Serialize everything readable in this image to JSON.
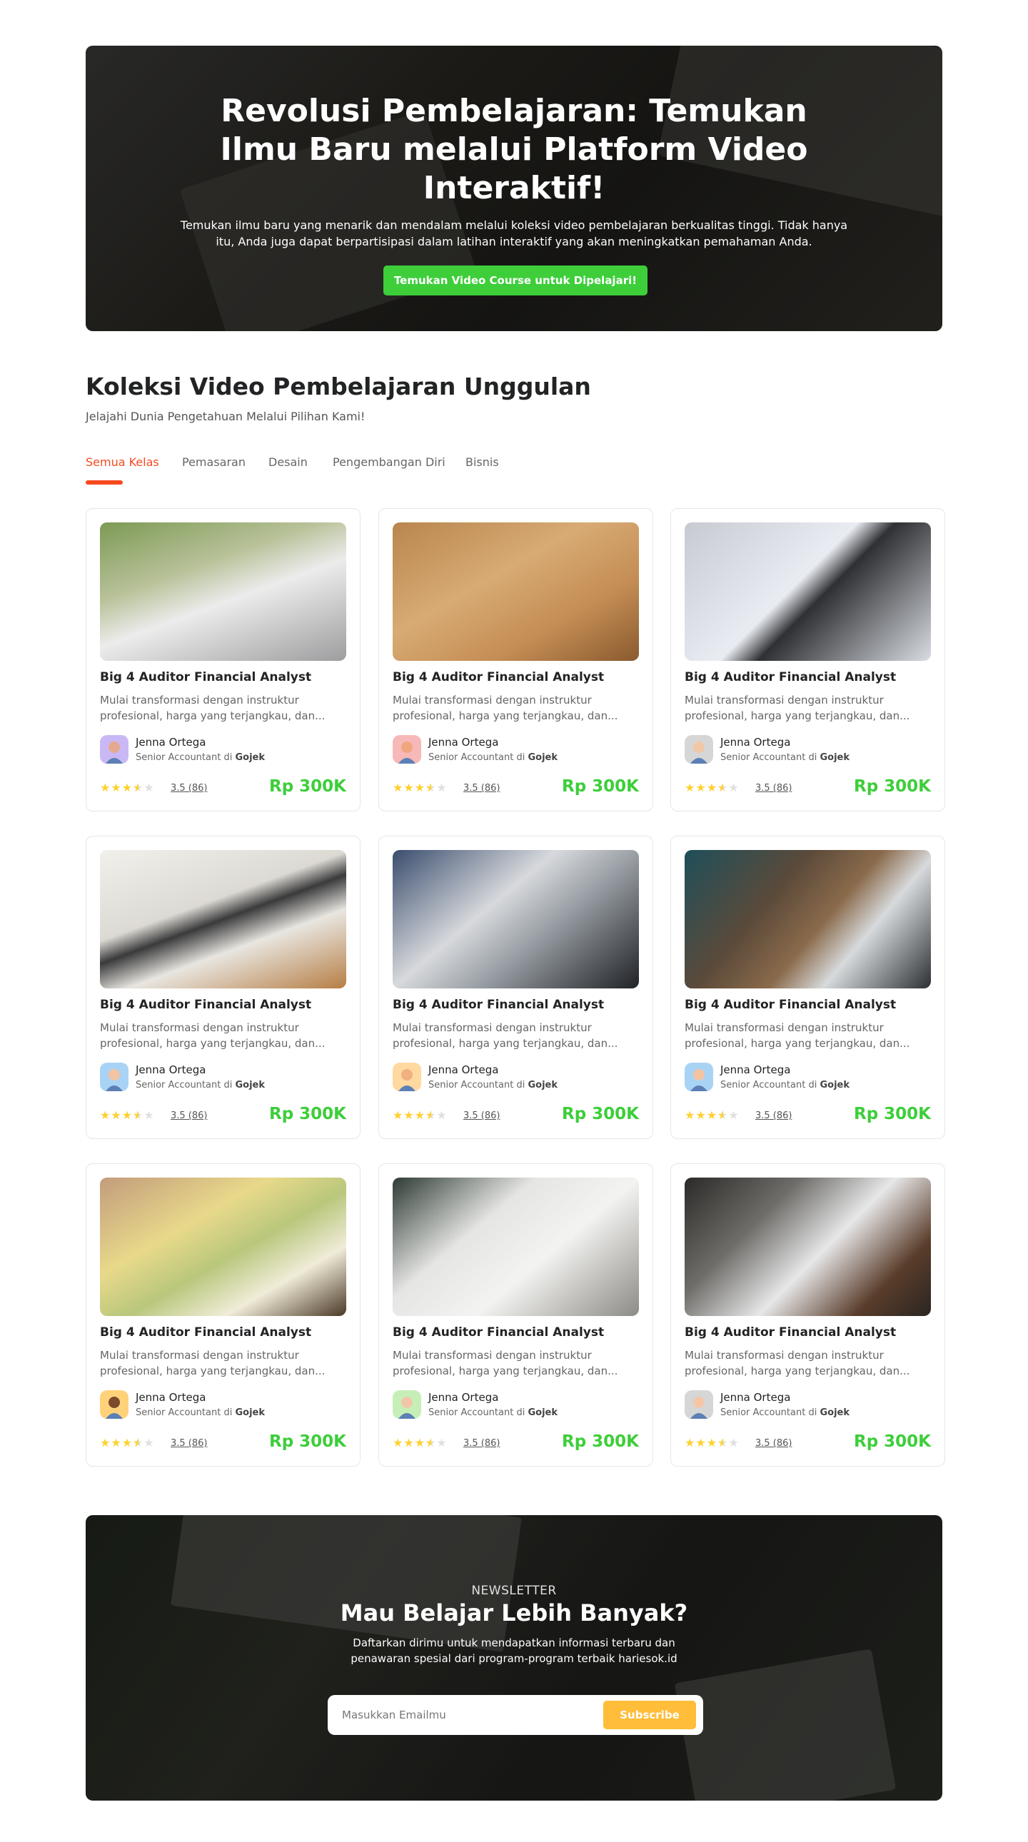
{
  "hero": {
    "title": "Revolusi Pembelajaran: Temukan Ilmu Baru melalui Platform Video Interaktif!",
    "description": "Temukan ilmu baru yang menarik dan mendalam melalui koleksi video pembelajaran berkualitas tinggi. Tidak hanya itu, Anda juga dapat berpartisipasi dalam latihan interaktif yang akan meningkatkan pemahaman Anda.",
    "cta_label": "Temukan Video Course untuk Dipelajari!"
  },
  "collection": {
    "title": "Koleksi Video Pembelajaran Unggulan",
    "subtitle": "Jelajahi Dunia Pengetahuan Melalui Pilihan Kami!",
    "tabs": [
      {
        "label": "Semua Kelas",
        "active": true
      },
      {
        "label": "Pemasaran",
        "active": false
      },
      {
        "label": "Desain",
        "active": false
      },
      {
        "label": "Pengembangan Diri",
        "active": false
      },
      {
        "label": "Bisnis",
        "active": false
      }
    ],
    "courses": [
      {
        "title": "Big 4 Auditor Financial Analyst",
        "description": "Mulai transformasi dengan instruktur profesional, harga yang terjangkau, dan...",
        "author": "Jenna Ortega",
        "role_prefix": "Senior Accountant di",
        "company": "Gojek",
        "rating": 3.5,
        "rating_label": "3.5 (86)",
        "price": "Rp 300K"
      },
      {
        "title": "Big 4 Auditor Financial Analyst",
        "description": "Mulai transformasi dengan instruktur profesional, harga yang terjangkau, dan...",
        "author": "Jenna Ortega",
        "role_prefix": "Senior Accountant di",
        "company": "Gojek",
        "rating": 3.5,
        "rating_label": "3.5 (86)",
        "price": "Rp 300K"
      },
      {
        "title": "Big 4 Auditor Financial Analyst",
        "description": "Mulai transformasi dengan instruktur profesional, harga yang terjangkau, dan...",
        "author": "Jenna Ortega",
        "role_prefix": "Senior Accountant di",
        "company": "Gojek",
        "rating": 3.5,
        "rating_label": "3.5 (86)",
        "price": "Rp 300K"
      },
      {
        "title": "Big 4 Auditor Financial Analyst",
        "description": "Mulai transformasi dengan instruktur profesional, harga yang terjangkau, dan...",
        "author": "Jenna Ortega",
        "role_prefix": "Senior Accountant di",
        "company": "Gojek",
        "rating": 3.5,
        "rating_label": "3.5 (86)",
        "price": "Rp 300K"
      },
      {
        "title": "Big 4 Auditor Financial Analyst",
        "description": "Mulai transformasi dengan instruktur profesional, harga yang terjangkau, dan...",
        "author": "Jenna Ortega",
        "role_prefix": "Senior Accountant di",
        "company": "Gojek",
        "rating": 3.5,
        "rating_label": "3.5 (86)",
        "price": "Rp 300K"
      },
      {
        "title": "Big 4 Auditor Financial Analyst",
        "description": "Mulai transformasi dengan instruktur profesional, harga yang terjangkau, dan...",
        "author": "Jenna Ortega",
        "role_prefix": "Senior Accountant di",
        "company": "Gojek",
        "rating": 3.5,
        "rating_label": "3.5 (86)",
        "price": "Rp 300K"
      },
      {
        "title": "Big 4 Auditor Financial Analyst",
        "description": "Mulai transformasi dengan instruktur profesional, harga yang terjangkau, dan...",
        "author": "Jenna Ortega",
        "role_prefix": "Senior Accountant di",
        "company": "Gojek",
        "rating": 3.5,
        "rating_label": "3.5 (86)",
        "price": "Rp 300K"
      },
      {
        "title": "Big 4 Auditor Financial Analyst",
        "description": "Mulai transformasi dengan instruktur profesional, harga yang terjangkau, dan...",
        "author": "Jenna Ortega",
        "role_prefix": "Senior Accountant di",
        "company": "Gojek",
        "rating": 3.5,
        "rating_label": "3.5 (86)",
        "price": "Rp 300K"
      },
      {
        "title": "Big 4 Auditor Financial Analyst",
        "description": "Mulai transformasi dengan instruktur profesional, harga yang terjangkau, dan...",
        "author": "Jenna Ortega",
        "role_prefix": "Senior Accountant di",
        "company": "Gojek",
        "rating": 3.5,
        "rating_label": "3.5 (86)",
        "price": "Rp 300K"
      }
    ]
  },
  "newsletter": {
    "label": "NEWSLETTER",
    "title": "Mau Belajar Lebih Banyak?",
    "description": "Daftarkan dirimu untuk mendapatkan informasi terbaru dan penawaran spesial dari program-program terbaik hariesok.id",
    "email_placeholder": "Masukkan Emailmu",
    "email_value": "",
    "subscribe_label": "Subscribe"
  },
  "colors": {
    "accent_orange": "#f64920",
    "price_green": "#3dce3a",
    "cta_green": "#3dce3a",
    "subscribe_yellow": "#ffbd3a",
    "star_yellow": "#fed12f"
  }
}
